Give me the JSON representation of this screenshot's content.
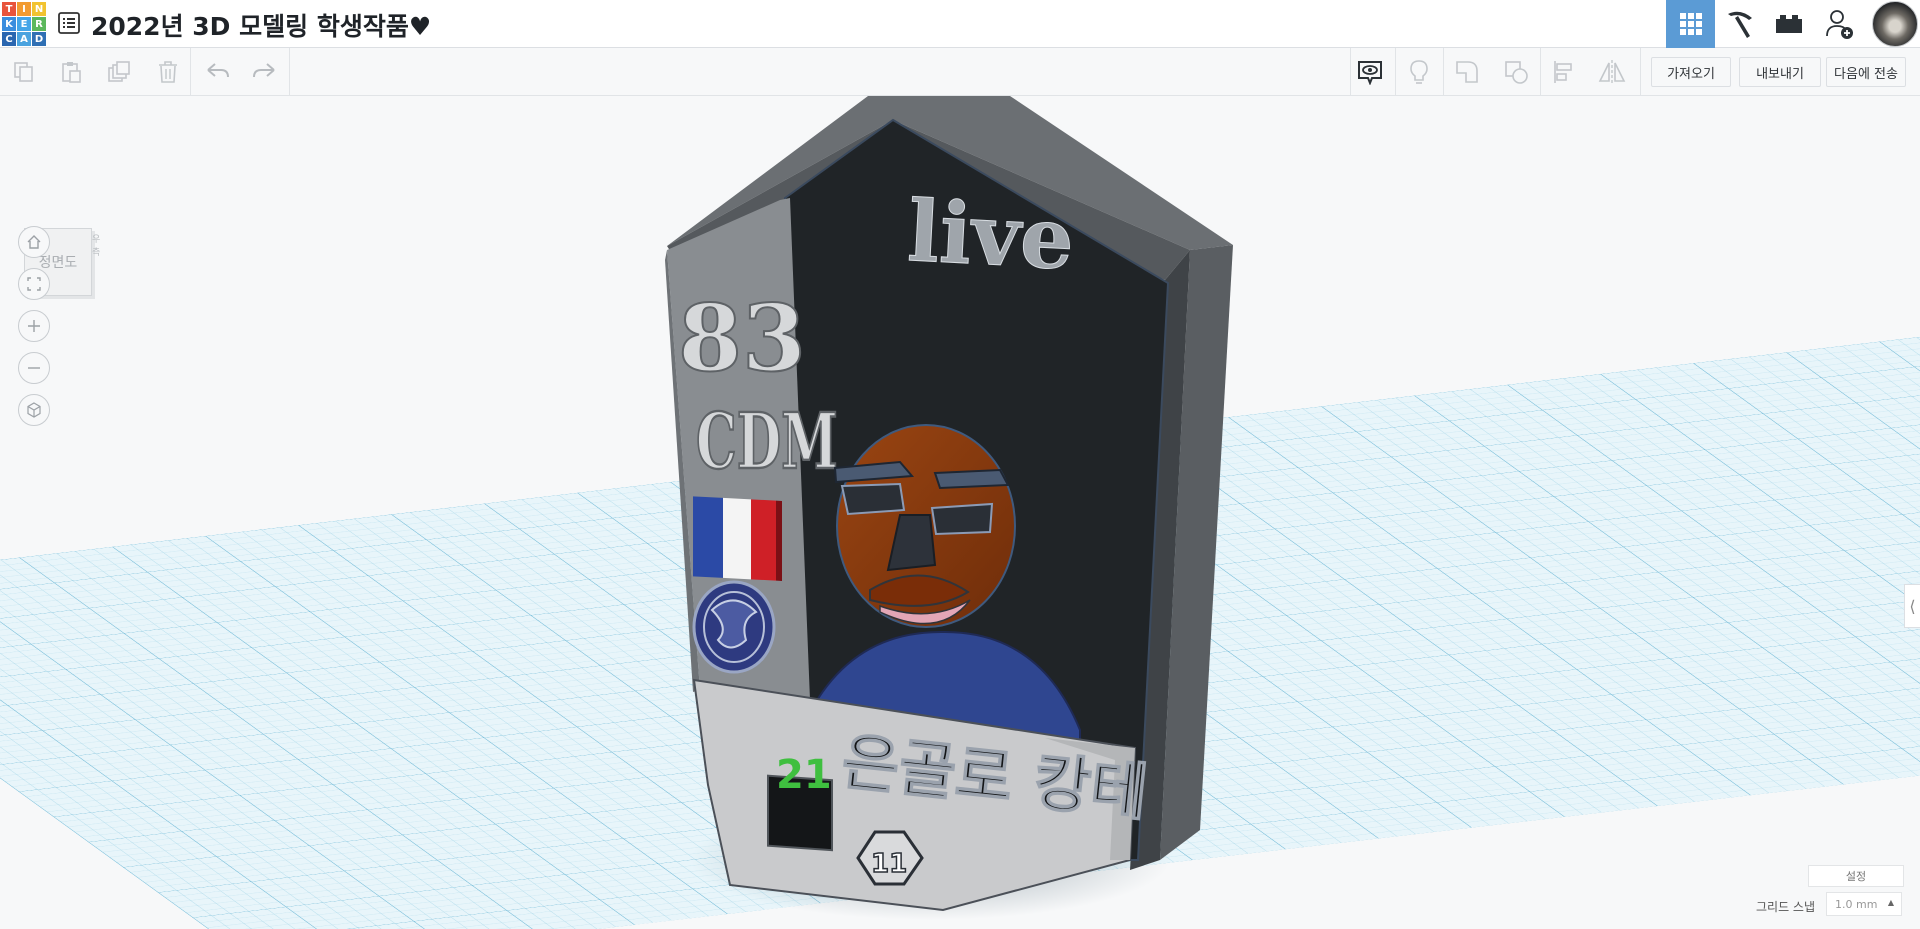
{
  "app": {
    "logo_letters": [
      "T",
      "I",
      "N",
      "K",
      "E",
      "R",
      "C",
      "A",
      "D"
    ],
    "logo_colors": [
      "#e8543c",
      "#f29b30",
      "#f2c330",
      "#3a8dde",
      "#44a5e8",
      "#5cb85c",
      "#2a66b0",
      "#4aa3df",
      "#2f6fb4"
    ]
  },
  "header": {
    "title": "2022년 3D 모델링 학생작품♥",
    "title_icon": "list-icon",
    "view_tabs": [
      {
        "icon": "grid-view-icon",
        "active": true
      },
      {
        "icon": "pickaxe-icon",
        "active": false
      },
      {
        "icon": "bricks-icon",
        "active": false
      }
    ],
    "user_icon": "add-user-icon",
    "avatar": "user-avatar"
  },
  "toolbar": {
    "left_tools": [
      "copy-icon",
      "paste-icon",
      "duplicate-icon",
      "delete-icon",
      "undo-icon",
      "redo-icon"
    ],
    "right_tools": [
      "notes-visibility-icon",
      "light-bulb-icon",
      "group-shape-icon",
      "ungroup-shape-icon",
      "align-icon",
      "mirror-icon"
    ],
    "import_label": "가져오기",
    "export_label": "내보내기",
    "send_to_label": "다음에 전송"
  },
  "viewport": {
    "nav_cube_label": "정면도",
    "nav_cube_side": "우측",
    "nav_buttons": [
      "home-view-icon",
      "fit-view-icon",
      "zoom-in-icon",
      "zoom-out-icon",
      "perspective-icon"
    ],
    "settings_label": "설정",
    "grid_snap_label": "그리드 스냅",
    "grid_snap_value": "1.0 mm"
  },
  "model": {
    "top_text": "live",
    "side_number": "83",
    "side_text": "CDM",
    "badge_number": "21",
    "name_text": "은골로 캉테",
    "emblem_text": "11",
    "flag_colors": [
      "#2b4aa6",
      "#f4f4f4",
      "#cf2027"
    ],
    "colors": {
      "frame": "#5a5e62",
      "panel": "#1f2326",
      "side_strip": "#8a8e93",
      "face": "#8a3a10",
      "body": "#2f4690",
      "base": "#c9cacc"
    }
  }
}
